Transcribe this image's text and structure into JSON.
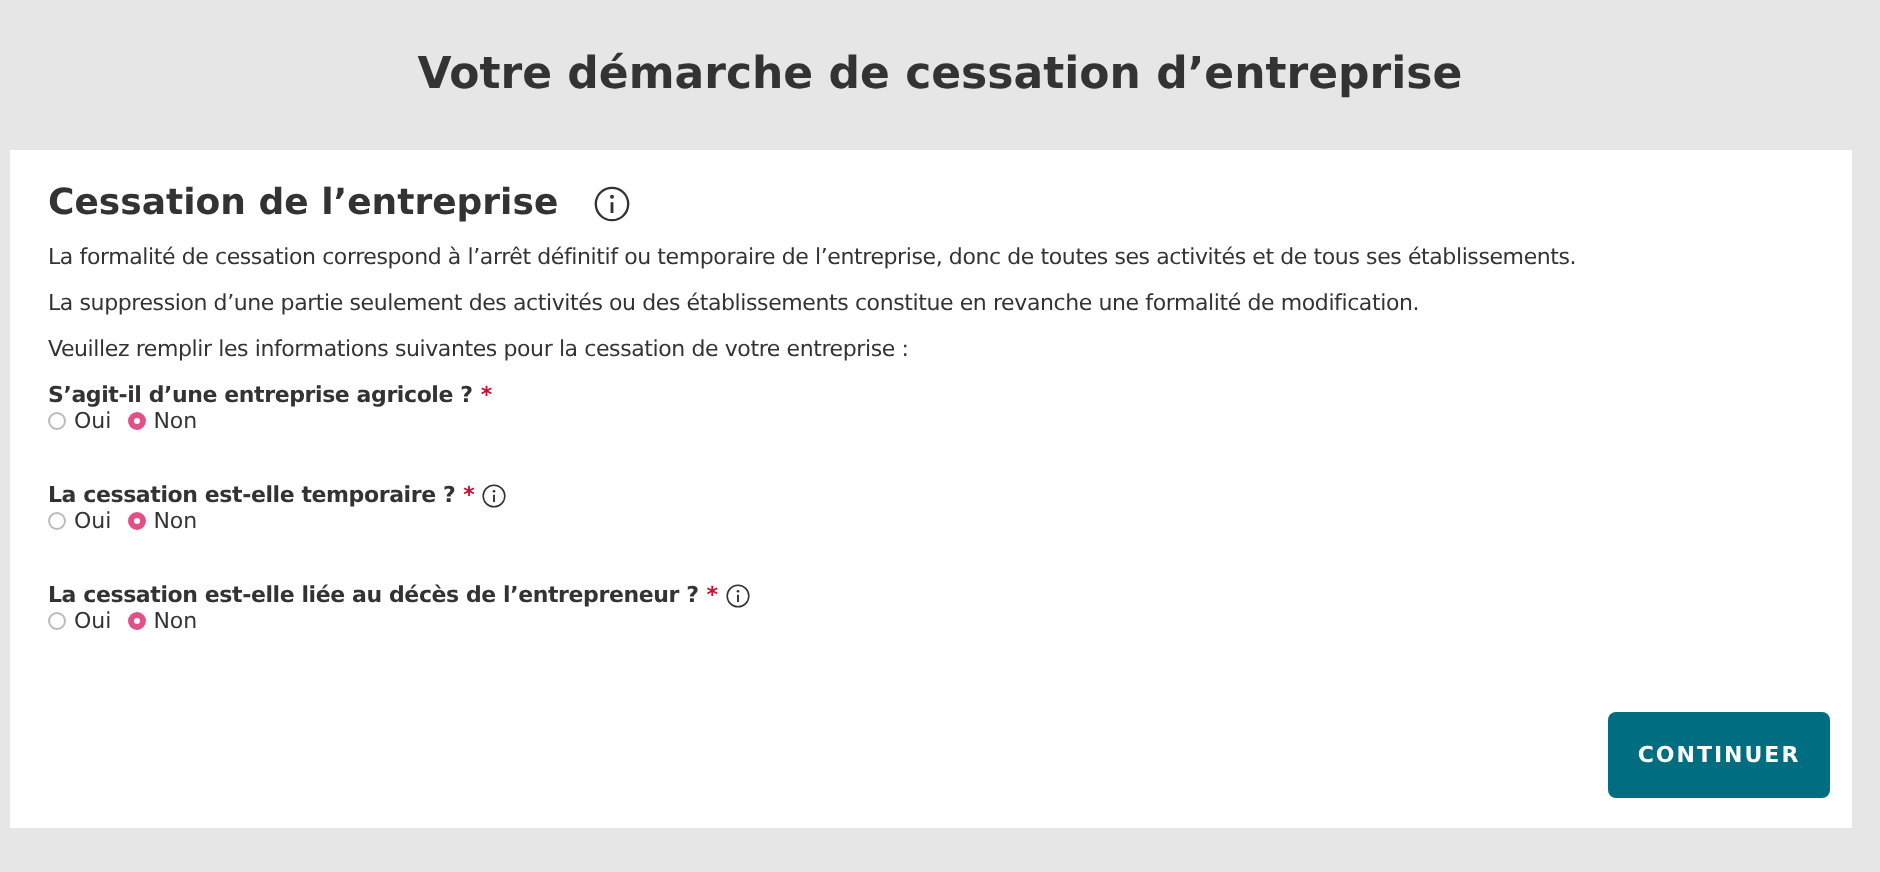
{
  "page_title": "Votre démarche de cessation d’entreprise",
  "section": {
    "title": "Cessation de l’entreprise",
    "info": true
  },
  "paragraphs": [
    "La formalité de cessation correspond à l’arrêt définitif ou temporaire de l’entreprise, donc de toutes ses activités et de tous ses établissements.",
    "La suppression d’une partie seulement des activités ou des établissements constitue en revanche une formalité de modification.",
    "Veuillez remplir les informations suivantes pour la cessation de votre entreprise :"
  ],
  "questions": [
    {
      "label": "S’agit-il d’une entreprise agricole ?",
      "required": "*",
      "info": false,
      "options": [
        {
          "label": "Oui",
          "selected": false
        },
        {
          "label": "Non",
          "selected": true
        }
      ]
    },
    {
      "label": "La cessation est-elle temporaire ?",
      "required": "*",
      "info": true,
      "options": [
        {
          "label": "Oui",
          "selected": false
        },
        {
          "label": "Non",
          "selected": true
        }
      ]
    },
    {
      "label": "La cessation est-elle liée au décès de l’entrepreneur ?",
      "required": "*",
      "info": true,
      "options": [
        {
          "label": "Oui",
          "selected": false
        },
        {
          "label": "Non",
          "selected": true
        }
      ]
    }
  ],
  "button": "CONTINUER"
}
